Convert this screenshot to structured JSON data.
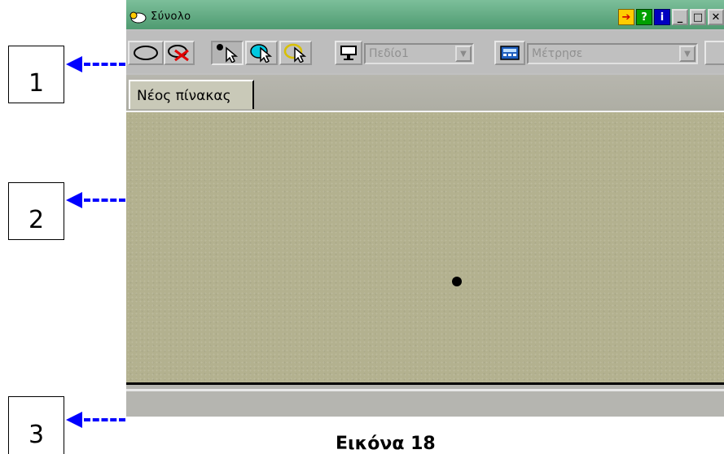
{
  "callouts": [
    {
      "label": "1"
    },
    {
      "label": "2"
    },
    {
      "label": "3"
    }
  ],
  "window": {
    "title": "Σύνολο",
    "title_buttons": [
      {
        "icon": "arrow-icon",
        "glyph": "➔"
      },
      {
        "icon": "help-icon",
        "glyph": "?"
      },
      {
        "icon": "info-icon",
        "glyph": "i"
      },
      {
        "icon": "minimize-icon",
        "glyph": "_"
      },
      {
        "icon": "maximize-icon",
        "glyph": "□"
      },
      {
        "icon": "close-icon",
        "glyph": "✕"
      }
    ]
  },
  "toolbar": {
    "field_combo": "Πεδίο1",
    "measure_combo": "Μέτρησε"
  },
  "tabs": [
    {
      "label": "Νέος πίνακας"
    }
  ],
  "caption": "Εικόνα 18",
  "colors": {
    "titlebar": "#5aa77d",
    "canvas": "#b3b18f",
    "arrow": "#0000ff"
  }
}
